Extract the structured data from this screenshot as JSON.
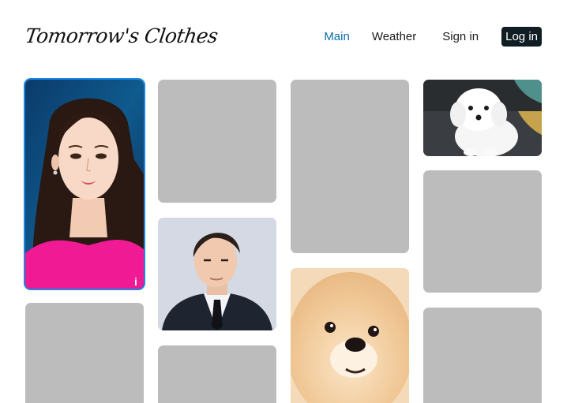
{
  "header": {
    "logo_text": "Tomorrow's Clothes",
    "nav": {
      "main_label": "Main",
      "weather_label": "Weather",
      "signin_label": "Sign in",
      "login_label": "Log in"
    },
    "active_nav": "Main",
    "colors": {
      "active_link": "#0a6ea8",
      "login_button_bg": "#101d22",
      "placeholder": "#bcbcbc",
      "selection_border": "#1a86e4"
    }
  },
  "gallery": {
    "items": [
      {
        "kind": "photo",
        "subject": "woman-portrait",
        "selected": true
      },
      {
        "kind": "placeholder"
      },
      {
        "kind": "placeholder"
      },
      {
        "kind": "photo",
        "subject": "man-in-suit"
      },
      {
        "kind": "placeholder"
      },
      {
        "kind": "placeholder"
      },
      {
        "kind": "photo",
        "subject": "pomeranian-dog"
      },
      {
        "kind": "photo",
        "subject": "white-puppy"
      },
      {
        "kind": "placeholder"
      },
      {
        "kind": "placeholder"
      }
    ]
  }
}
